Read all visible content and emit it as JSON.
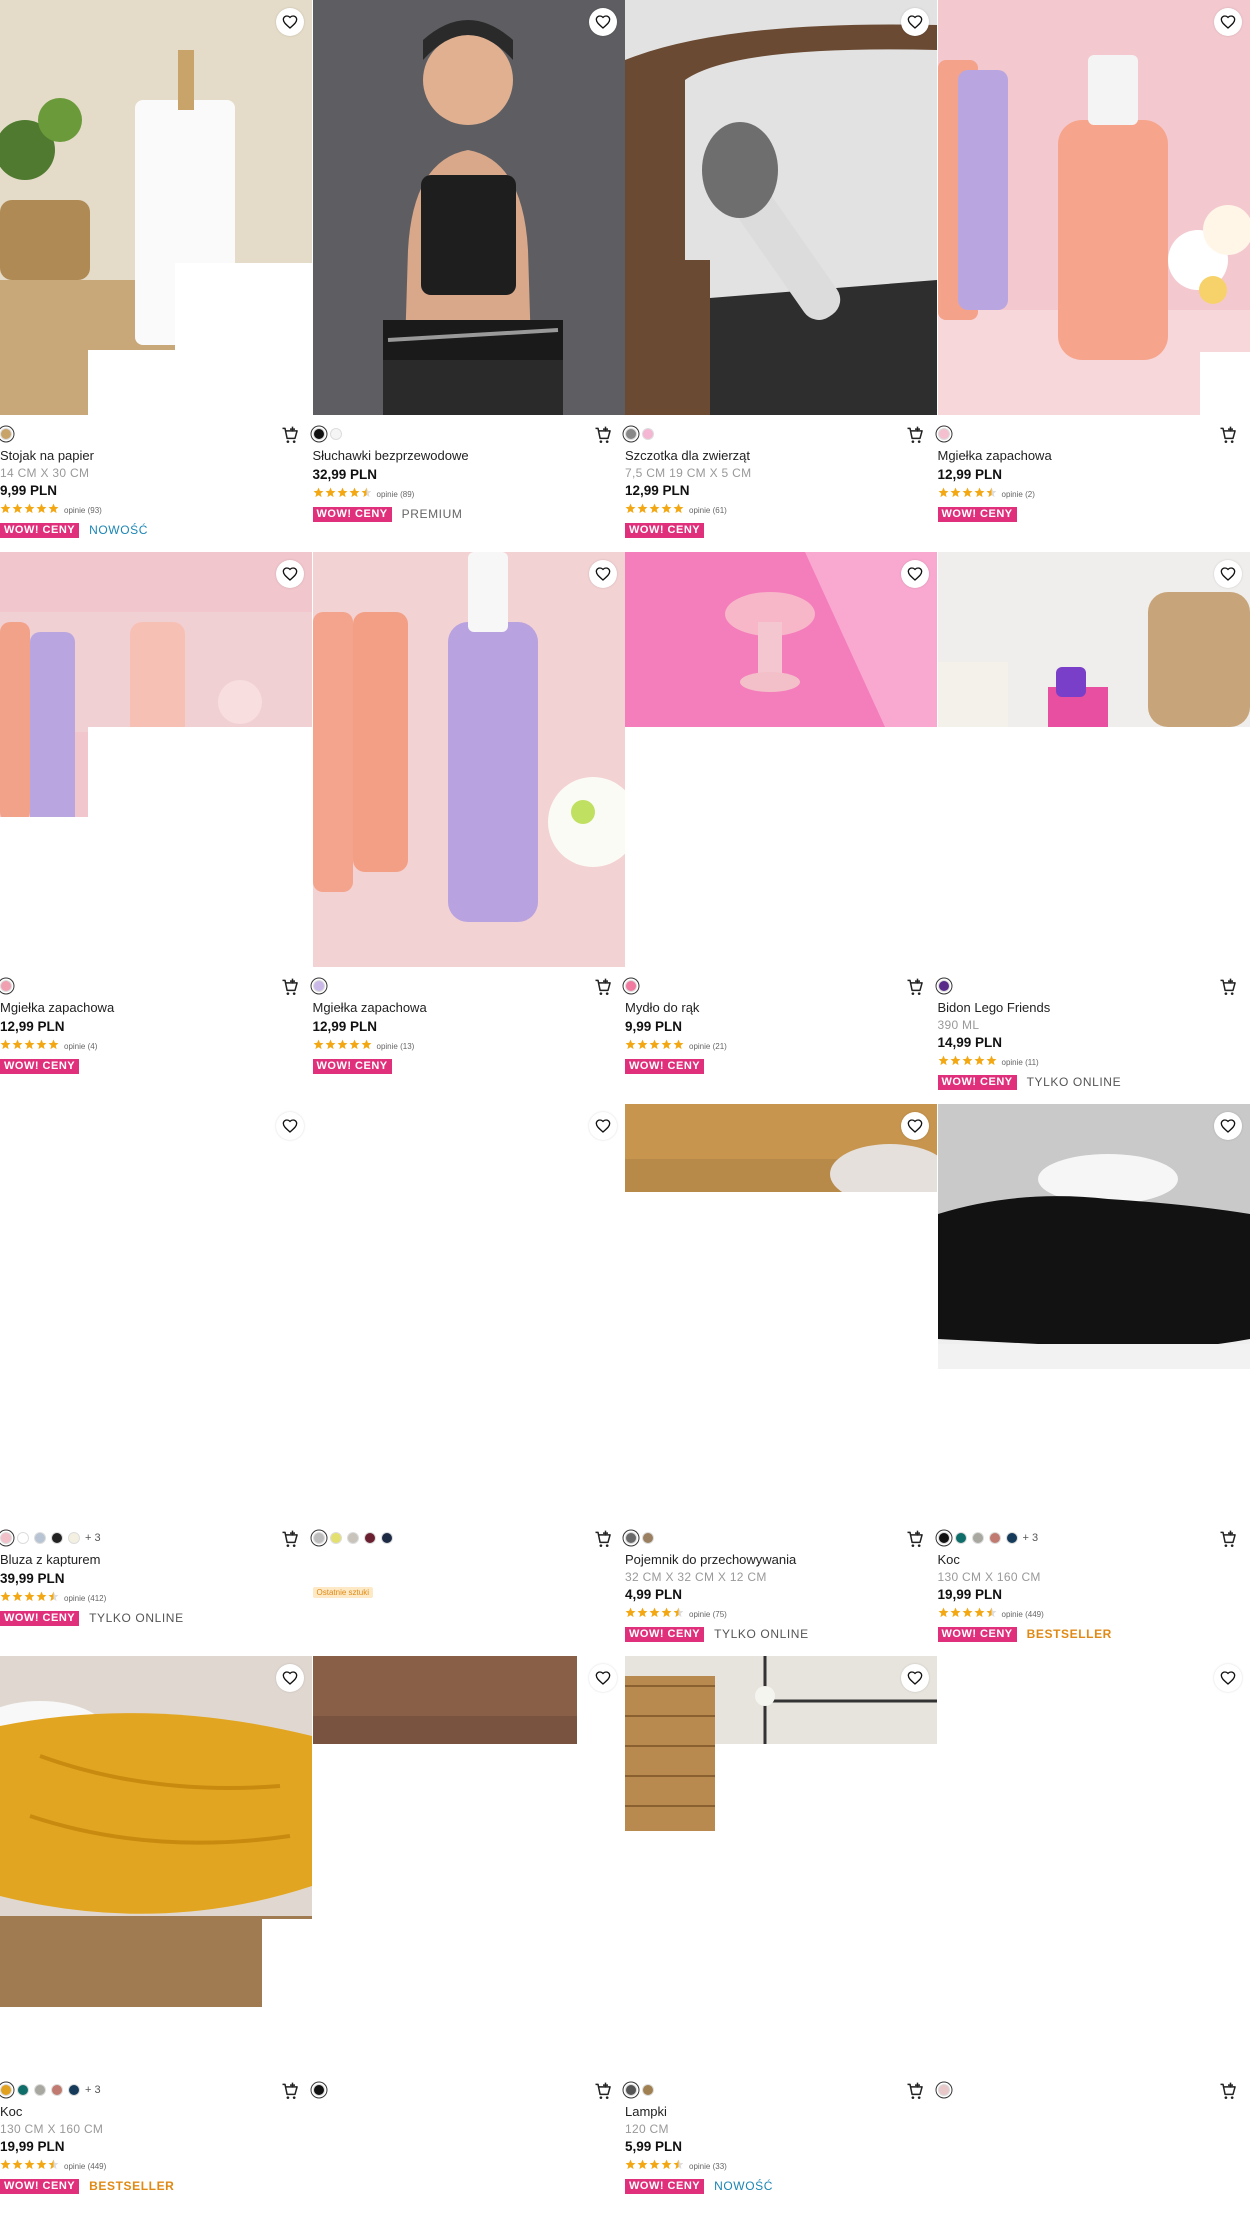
{
  "colors": {
    "wow": "#e0307c",
    "new": "#1b86b5",
    "bestseller": "#e08a16",
    "star": "#f3a712"
  },
  "products": [
    {
      "name": "Stojak na papier",
      "size": "14 CM X 30 CM",
      "price": "9,99 PLN",
      "rating": 5,
      "reviews": "opinie (93)",
      "wow": "WOW! CENY",
      "tag": "NOWOŚĆ",
      "tag_type": "nowosc",
      "swatches": [
        "#c9a46a"
      ],
      "more": ""
    },
    {
      "name": "Słuchawki bezprzewodowe",
      "size": "",
      "price": "32,99 PLN",
      "rating": 4.5,
      "reviews": "opinie (89)",
      "wow": "WOW! CENY",
      "tag": "PREMIUM",
      "tag_type": "premium",
      "swatches": [
        "#111111",
        "#f5f5f5"
      ],
      "more": ""
    },
    {
      "name": "Szczotka dla zwierząt",
      "size": "7,5 CM 19 CM X 5 CM",
      "price": "12,99 PLN",
      "rating": 5,
      "reviews": "opinie (61)",
      "wow": "WOW! CENY",
      "tag": "",
      "tag_type": "",
      "swatches": [
        "#888888",
        "#f4b6d2"
      ],
      "more": ""
    },
    {
      "name": "Mgiełka zapachowa",
      "size": "",
      "price": "12,99 PLN",
      "rating": 4.5,
      "reviews": "opinie (2)",
      "wow": "WOW! CENY",
      "tag": "",
      "tag_type": "",
      "swatches": [
        "#f4c0cf"
      ],
      "more": ""
    },
    {
      "name": "Mgiełka zapachowa",
      "size": "",
      "price": "12,99 PLN",
      "rating": 5,
      "reviews": "opinie (4)",
      "wow": "WOW! CENY",
      "tag": "",
      "tag_type": "",
      "swatches": [
        "#f0a0b0"
      ],
      "more": ""
    },
    {
      "name": "Mgiełka zapachowa",
      "size": "",
      "price": "12,99 PLN",
      "rating": 5,
      "reviews": "opinie (13)",
      "wow": "WOW! CENY",
      "tag": "",
      "tag_type": "",
      "swatches": [
        "#c9b8e8"
      ],
      "more": ""
    },
    {
      "name": "Mydło do rąk",
      "size": "",
      "price": "9,99 PLN",
      "rating": 5,
      "reviews": "opinie (21)",
      "wow": "WOW! CENY",
      "tag": "",
      "tag_type": "",
      "swatches": [
        "#f07aa0"
      ],
      "more": ""
    },
    {
      "name": "Bidon Lego Friends",
      "size": "390 ML",
      "price": "14,99 PLN",
      "rating": 5,
      "reviews": "opinie (11)",
      "wow": "WOW! CENY",
      "tag": "TYLKO ONLINE",
      "tag_type": "online",
      "swatches": [
        "#5a2a8a"
      ],
      "more": ""
    },
    {
      "name": "Bluza z kapturem",
      "size": "",
      "price": "39,99 PLN",
      "rating": 4.5,
      "reviews": "opinie (412)",
      "wow": "WOW! CENY",
      "tag": "TYLKO ONLINE",
      "tag_type": "online",
      "swatches": [
        "#f2c0c8",
        "#ffffff",
        "#b8c4d4",
        "#222222",
        "#f3f0e2"
      ],
      "more": "+ 3"
    },
    {
      "name": "",
      "size": "",
      "price": "",
      "rating": 0,
      "reviews": "",
      "wow": "",
      "tag": "",
      "tag_type": "",
      "swatches": [
        "#bdbdbd",
        "#e4e070",
        "#c8c4bc",
        "#6a2030",
        "#1c2a44"
      ],
      "more": "",
      "last": "Ostatnie sztuki"
    },
    {
      "name": "Pojemnik do przechowywania",
      "size": "32 CM X 32 CM X 12 CM",
      "price": "4,99 PLN",
      "rating": 4.5,
      "reviews": "opinie (75)",
      "wow": "WOW! CENY",
      "tag": "TYLKO ONLINE",
      "tag_type": "online",
      "swatches": [
        "#6a6a6a",
        "#9a8060"
      ],
      "more": ""
    },
    {
      "name": "Koc",
      "size": "130 CM X 160 CM",
      "price": "19,99 PLN",
      "rating": 4.5,
      "reviews": "opinie (449)",
      "wow": "WOW! CENY",
      "tag": "BESTSELLER",
      "tag_type": "best",
      "swatches": [
        "#111111",
        "#0f6e6a",
        "#a8a8a0",
        "#c07a70",
        "#163a5a"
      ],
      "more": "+ 3"
    },
    {
      "name": "Koc",
      "size": "130 CM X 160 CM",
      "price": "19,99 PLN",
      "rating": 4.5,
      "reviews": "opinie (449)",
      "wow": "WOW! CENY",
      "tag": "BESTSELLER",
      "tag_type": "best",
      "swatches": [
        "#e0a020",
        "#0f6e6a",
        "#a8a8a0",
        "#c07a70",
        "#163a5a"
      ],
      "more": "+ 3"
    },
    {
      "name": "",
      "size": "",
      "price": "",
      "rating": 0,
      "reviews": "",
      "wow": "",
      "tag": "",
      "tag_type": "",
      "swatches": [
        "#111111"
      ],
      "more": ""
    },
    {
      "name": "Lampki",
      "size": "120 CM",
      "price": "5,99 PLN",
      "rating": 4.5,
      "reviews": "opinie (33)",
      "wow": "WOW! CENY",
      "tag": "NOWOŚĆ",
      "tag_type": "nowosc",
      "swatches": [
        "#555555",
        "#a08050"
      ],
      "more": ""
    },
    {
      "name": "",
      "size": "",
      "price": "",
      "rating": 0,
      "reviews": "",
      "wow": "",
      "tag": "",
      "tag_type": "",
      "swatches": [
        "#e8c8c8"
      ],
      "more": ""
    }
  ]
}
